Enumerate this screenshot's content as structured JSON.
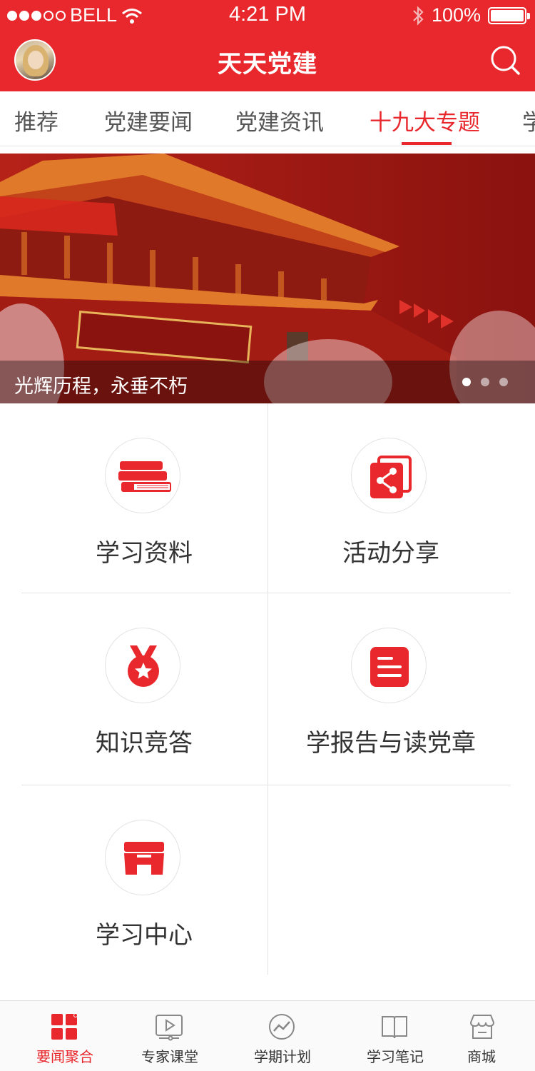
{
  "status_bar": {
    "carrier": "BELL",
    "time": "4:21 PM",
    "battery": "100%"
  },
  "nav": {
    "title": "天天党建"
  },
  "tabs": [
    {
      "label": "推荐"
    },
    {
      "label": "党建要闻"
    },
    {
      "label": "党建资讯"
    },
    {
      "label": "十九大专题"
    },
    {
      "label": "学"
    }
  ],
  "banner": {
    "caption": "光辉历程，永垂不朽"
  },
  "grid": [
    {
      "label": "学习资料",
      "icon": "books-icon"
    },
    {
      "label": "活动分享",
      "icon": "share-icon"
    },
    {
      "label": "知识竞答",
      "icon": "medal-icon"
    },
    {
      "label": "学报告与读党章",
      "icon": "document-icon"
    },
    {
      "label": "学习中心",
      "icon": "archive-box-icon"
    }
  ],
  "tabbar": [
    {
      "label": "要闻聚合",
      "icon": "grid-icon"
    },
    {
      "label": "专家课堂",
      "icon": "video-icon"
    },
    {
      "label": "学期计划",
      "icon": "trend-icon"
    },
    {
      "label": "学习笔记",
      "icon": "book-icon"
    },
    {
      "label": "商城",
      "icon": "store-icon"
    }
  ],
  "colors": {
    "accent": "#e8282c",
    "text": "#333333",
    "divider": "#e3e3e3"
  }
}
